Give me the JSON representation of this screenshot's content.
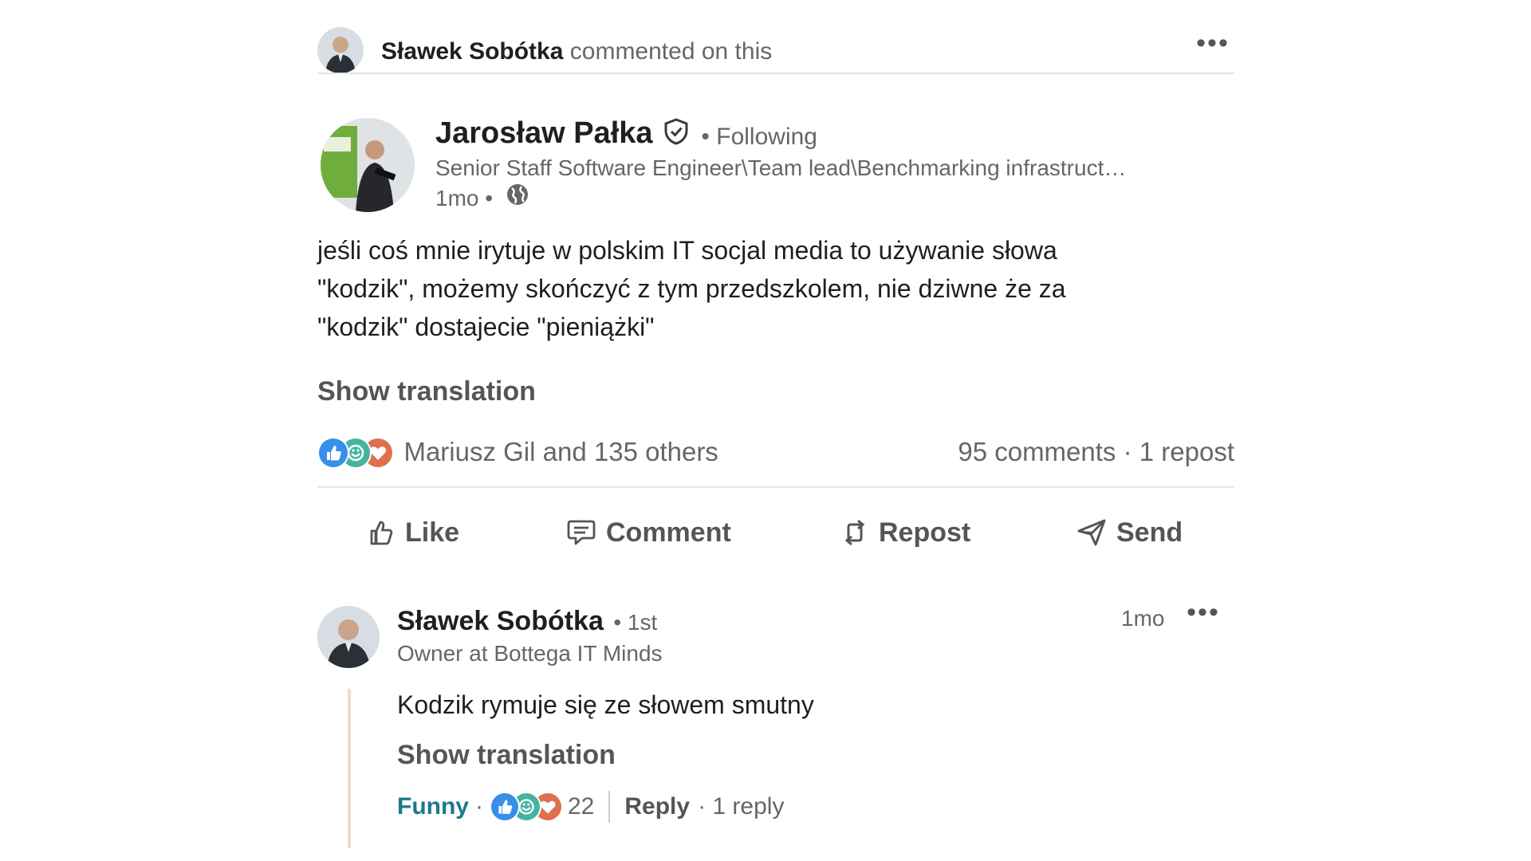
{
  "header": {
    "commenter_name": "Sławek Sobótka",
    "action_text": "commented on this",
    "more_label": "•••"
  },
  "post": {
    "author_name": "Jarosław Pałka",
    "following_text": "• Following",
    "headline": "Senior Staff Software Engineer\\Team lead\\Benchmarking infrastruct…",
    "time": "1mo •",
    "body_lines": [
      "jeśli coś mnie irytuje w polskim IT socjal media to używanie słowa",
      "\"kodzik\", możemy skończyć z tym przedszkolem, nie dziwne że za",
      "\"kodzik\" dostajecie \"pieniążki\""
    ],
    "show_translation": "Show translation",
    "reactions_text": "Mariusz Gil and 135 others",
    "counts_text": "95 comments · 1 repost",
    "reaction_icons": [
      "like-reaction-icon",
      "celebrate-reaction-icon",
      "love-reaction-icon"
    ]
  },
  "actions": {
    "like": "Like",
    "comment": "Comment",
    "repost": "Repost",
    "send": "Send"
  },
  "comment": {
    "author_name": "Sławek Sobótka",
    "degree": "• 1st",
    "headline": "Owner at Bottega IT Minds",
    "time": "1mo",
    "more_label": "•••",
    "body": "Kodzik rymuje się ze słowem smutny",
    "show_translation": "Show translation",
    "reaction_label": "Funny",
    "dot": "·",
    "reaction_count": "22",
    "reply_label": "Reply",
    "reply_count": "· 1 reply"
  },
  "colors": {
    "like_blue": "#378fe9",
    "celebrate_teal": "#44b3a0",
    "love_red": "#df704d",
    "funny_teal": "#1b7a8a",
    "divider": "#e3e3e3"
  }
}
